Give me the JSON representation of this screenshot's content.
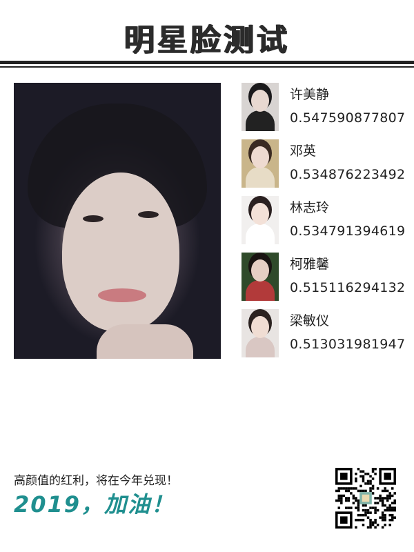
{
  "header": {
    "title": "明星脸测试"
  },
  "matches": [
    {
      "name": "许美静",
      "score": "0.547590877807",
      "thumb_bg": "#d8d4d2",
      "hair": "#1b1a1c",
      "skin": "#e8d8d0",
      "cloth": "#222222"
    },
    {
      "name": "邓英",
      "score": "0.534876223492",
      "thumb_bg": "#c9b58a",
      "hair": "#3a2a22",
      "skin": "#eedad0",
      "cloth": "#e7dcc6"
    },
    {
      "name": "林志玲",
      "score": "0.534791394619",
      "thumb_bg": "#f1efee",
      "hair": "#2a2020",
      "skin": "#f3e1d8",
      "cloth": "#ffffff"
    },
    {
      "name": "柯雅馨",
      "score": "0.515116294132",
      "thumb_bg": "#2f4a2a",
      "hair": "#1a1412",
      "skin": "#e6cfc4",
      "cloth": "#b23a3a"
    },
    {
      "name": "梁敏仪",
      "score": "0.513031981947",
      "thumb_bg": "#e8e4e2",
      "hair": "#2b2220",
      "skin": "#f0ddd3",
      "cloth": "#d9c7c3"
    }
  ],
  "footer": {
    "slogan": "高颜值的红利，将在今年兑现！",
    "cheer": "2019，加油！"
  },
  "colors": {
    "accent": "#1f8f8f",
    "rule": "#222222"
  }
}
